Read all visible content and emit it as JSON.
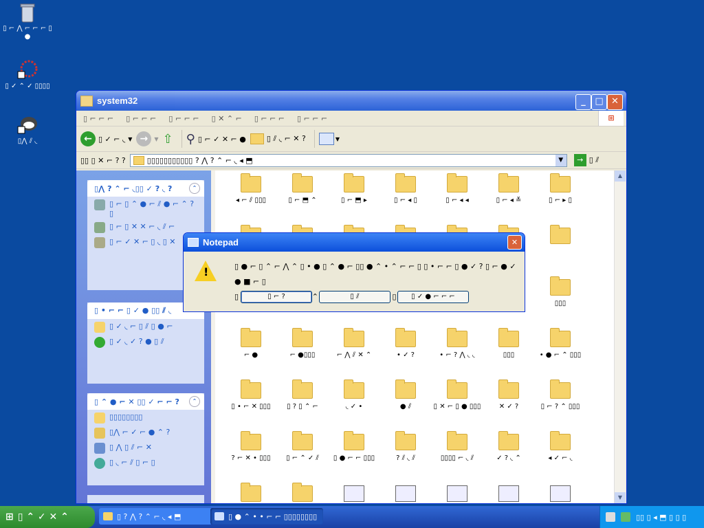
{
  "desktop": {
    "icons": [
      {
        "label": "▯ ⌐ ⋀ ⌐ ⌐ ⌐ ▯ ●",
        "name": "recycle-bin-icon"
      },
      {
        "label": "▯ ✓ ⌃ ✓ ▯▯▯▯",
        "name": "internet-icon"
      },
      {
        "label": "▯⋀ ⫽ ◟",
        "name": "app-shortcut-icon"
      }
    ]
  },
  "explorer": {
    "title": "system32",
    "menu": [
      "▯ ⌐ ⌐ ⌐",
      "▯ ⌐ ⌐ ⌐",
      "▯ ⌐ ⌐ ⌐",
      "▯ ✕ ⌃ ⌐",
      "▯ ⌐ ⌐ ⌐",
      "▯ ⌐ ⌐ ⌐"
    ],
    "toolbar": {
      "back": "▯ ✓ ⌐ ◟",
      "search": "▯ ⌐ ✓ ✕ ⌐ ●",
      "folders": "▯ ⫽ ◟ ⌐ ✕ ?"
    },
    "address": {
      "label": "▯▯ ▯ ✕ ⌐ ? ?",
      "path": "▯▯▯▯▯▯▯▯▯▯▯ ? ⋀ ? ⌃ ⌐ ◟ ◂ ⬒",
      "go": "▯ ⫽"
    },
    "tasks_panels": [
      {
        "title": "▯⋀ ? ⌃ ⌐ ◟▯▯ ✓ ? ◟ ?",
        "items": [
          "▯ ⌐ ▯ ⌃ ● ⌐ ⫽ ● ⌐ ⌃ ? ▯",
          "▯ ⌐ ▯ ✕ ✕ ⌐ ◟ ⫽ ⌐",
          "▯ ⌐ ✓ ✕ ⌐ ▯ ◟ ▯ ✕"
        ]
      },
      {
        "title": "▯ • ⌐ ⌐ ▯ ✓ ● ▯▯ ⫽ ◟",
        "items": [
          "▯ ✓ ◟ ⌐ ▯ ⫽ ▯ ● ⌐",
          "▯ ✓ ◟ ✓ ? ● ▯ ⫽"
        ]
      },
      {
        "title": "▯ ⌃ ● ⌐ ✕ ▯▯ ✓ ⌐ ⌐ ?",
        "items": [
          "▯▯▯▯▯▯▯▯",
          "▯⋀ ⌐ ✓ ⌐ ● ⌃ ?",
          "▯ ⋀ ▯ ⫽ ⌐ ✕",
          "▯ ◟ ⌐ ⫽ ▯ ⌐ ▯"
        ]
      }
    ],
    "files": [
      "◂ ⌐ ⫽ ▯▯▯",
      "▯ ⌐ ⬒ ⌃",
      "▯ ⌐ ⬒ ▸",
      "▯ ⌐ ◂ ▯",
      "▯ ⌐ ◂ ◂",
      "▯ ⌐ ◂ ≚",
      "▯ ⌐ ▸ ▯",
      "",
      "",
      "",
      "",
      "",
      "▯ ✓ ▯ ⫽ ⫽ ⌃",
      "",
      "",
      "",
      "",
      "",
      "",
      "",
      "▯▯▯",
      "⌐ ●",
      "⌐ ●▯▯▯",
      "⌐ ⋀ ⫽ ✕ ⌃",
      "• ✓ ?",
      "• ⌐ ? ⋀ ◟ ◟",
      "▯▯▯",
      "• ● ⌐ ⌃ ▯▯▯",
      "▯ • ⌐ ✕ ▯▯▯",
      "▯ ? ▯ ⌃ ⌐",
      "◟ ✓ •",
      "● ⫽",
      "▯ ✕ ⌐ ▯ ● ▯▯▯",
      "✕ ✓ ?",
      "▯ ⌐ ? ⌃ ▯▯▯",
      "? ⌐ ✕ • ▯▯▯",
      "▯ ⌐ ⌃ ✓ ⫽",
      "▯ ● ⌐ ⌐ ▯▯▯",
      "? ⫽ ◟ ⫽",
      "▯▯▯▯ ⌐ ◟ ⫽",
      "✓ ? ◟ ⌃",
      "◂ ✓ ⌐ ◟"
    ]
  },
  "dialog": {
    "title": "Notepad",
    "line1": "▯ ● ⌐ ▯ ⌃ ⌐ ⋀ ⌃ ▯ • ● ▯ ⌃ ● ⌐ ▯▯ ● ⌃ • ⌃ ⌐ ⌐ ▯ ▯ • ⌐ ⌐ ▯ ● ✓ ? ▯ ⌐ ● ✓ ● ■ ⌐ ▯",
    "line2": "▯ ⫽ ⋀ ⋀ ⌃ ▯ ◂ ✓ ● ⌃ ⌃ ⫽ ? ✓ ≑ ⌐ ▯ ⌃ ● ⌐ ▯ ⌐ ● ✓ ● ■ ⌐ ? ▯",
    "buttons": [
      "▯ ⌐ ?",
      "▯ ⫽",
      "▯ ✓ ● ⌐ ⌐ ⌐"
    ]
  },
  "taskbar": {
    "start": "▯ ⌃ ✓ ✕ ⌃",
    "tasks": [
      "▯ ? ⋀ ? ⌃ ⌐ ◟ ◂ ⬒",
      "▯ ● ⌃ • • ⌐ ⌐ ▯▯▯▯▯▯▯▯"
    ],
    "clock": "▯▯ ▯ ◂ ⬒ ▯ ▯ ▯"
  }
}
